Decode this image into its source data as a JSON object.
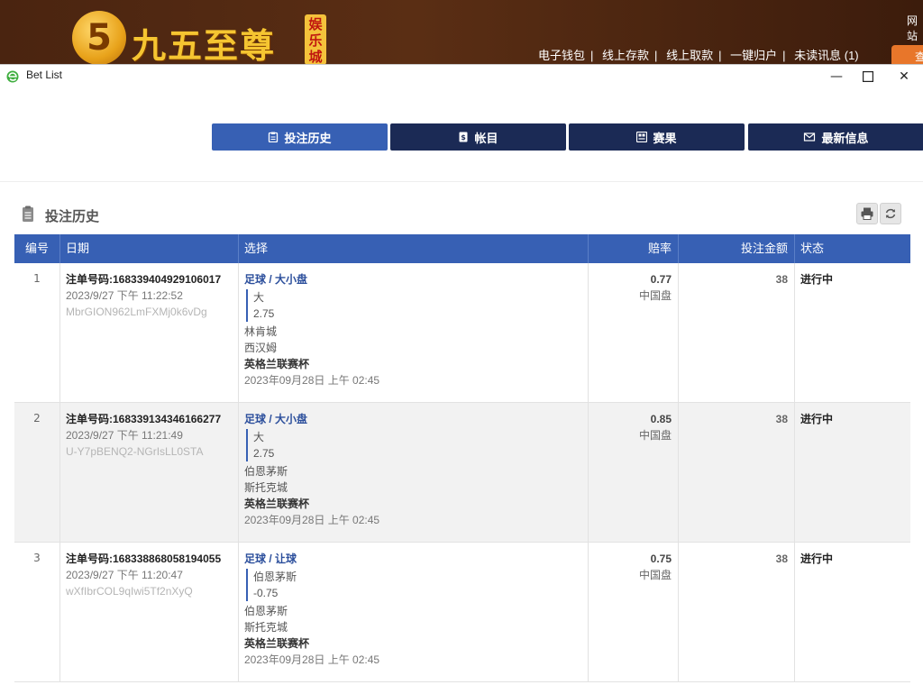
{
  "site": {
    "logo_digit": "5",
    "logo_text": "九五至尊",
    "logo_badge": "娱乐城",
    "nav": [
      "电子钱包",
      "线上存款",
      "线上取款",
      "一键归户",
      "未读讯息 (1)"
    ],
    "corner_text": "网站",
    "corner_button": "查"
  },
  "window": {
    "title": "Bet List",
    "minimize": "—",
    "close": "✕"
  },
  "tabs": [
    {
      "label": "投注历史",
      "icon": "clipboard-icon",
      "active": true
    },
    {
      "label": "帐目",
      "icon": "ledger-icon",
      "active": false
    },
    {
      "label": "赛果",
      "icon": "scoreboard-icon",
      "active": false
    },
    {
      "label": "最新信息",
      "icon": "envelope-icon",
      "active": false
    }
  ],
  "section": {
    "title": "投注历史",
    "print_icon": "printer-icon",
    "refresh_icon": "refresh-icon"
  },
  "table": {
    "headers": {
      "no": "编号",
      "date": "日期",
      "selection": "选择",
      "odds": "赔率",
      "amount": "投注金额",
      "status": "状态"
    },
    "rows": [
      {
        "no": "1",
        "ref": "注单号码:168339404929106017",
        "placed": "2023/9/27 下午 11:22:52",
        "code": "MbrGION962LmFXMj0k6vDg",
        "sport": "足球 / 大小盘",
        "pick": "大",
        "line": "2.75",
        "home": "林肯城",
        "away": "西汉姆",
        "league": "英格兰联赛杯",
        "event_time": "2023年09月28日 上午 02:45",
        "odds": "0.77",
        "odds_type": "中国盘",
        "amount": "38",
        "status": "进行中"
      },
      {
        "no": "2",
        "ref": "注单号码:168339134346166277",
        "placed": "2023/9/27 下午 11:21:49",
        "code": "U-Y7pBENQ2-NGrIsLL0STA",
        "sport": "足球 / 大小盘",
        "pick": "大",
        "line": "2.75",
        "home": "伯恩茅斯",
        "away": "斯托克城",
        "league": "英格兰联赛杯",
        "event_time": "2023年09月28日 上午 02:45",
        "odds": "0.85",
        "odds_type": "中国盘",
        "amount": "38",
        "status": "进行中"
      },
      {
        "no": "3",
        "ref": "注单号码:168338868058194055",
        "placed": "2023/9/27 下午 11:20:47",
        "code": "wXfIbrCOL9qIwi5Tf2nXyQ",
        "sport": "足球 / 让球",
        "pick": "伯恩茅斯",
        "line": "-0.75",
        "home": "伯恩茅斯",
        "away": "斯托克城",
        "league": "英格兰联赛杯",
        "event_time": "2023年09月28日 上午 02:45",
        "odds": "0.75",
        "odds_type": "中国盘",
        "amount": "38",
        "status": "进行中"
      }
    ]
  },
  "colors": {
    "header_blue": "#3760b4",
    "tab_navy": "#1b2a55",
    "site_brown": "#4a2410"
  }
}
